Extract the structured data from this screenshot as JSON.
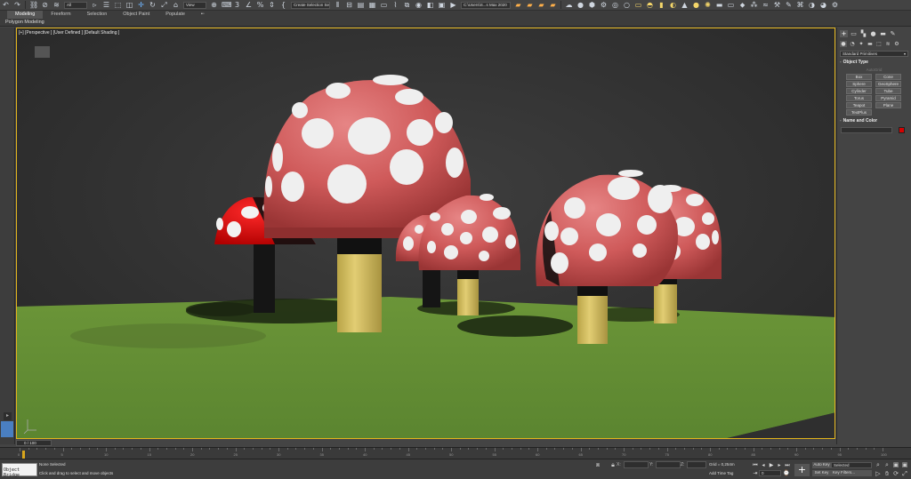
{
  "toolbar": {
    "icons_left": [
      "undo-icon",
      "redo-icon",
      "link-icon",
      "unlink-icon",
      "bind-space-warp-icon"
    ],
    "selection_filter": "All",
    "view_dropdown": "View",
    "named_selection": "Create Selection Se",
    "workspace": "C:\\Users\\S...s Max 2020"
  },
  "ribbon": {
    "tabs": [
      "Modeling",
      "Freeform",
      "Selection",
      "Object Paint",
      "Populate"
    ],
    "active_tab": "Modeling",
    "sub_label": "Polygon Modeling"
  },
  "viewport": {
    "label": "[+] [Perspective ] [User Defined ] [Default Shading ]"
  },
  "command_panel": {
    "primitive_type": "Standard Primitives",
    "object_type_title": "Object Type",
    "autogrid": "AutoGrid",
    "buttons": [
      "Box",
      "Cone",
      "Sphere",
      "GeoSphere",
      "Cylinder",
      "Tube",
      "Torus",
      "Pyramid",
      "Teapot",
      "Plane",
      "TextPlus"
    ],
    "name_color_title": "Name and Color",
    "object_color": "#d60000"
  },
  "timeline": {
    "frame_counter": "0 / 100",
    "ticks": [
      0,
      5,
      10,
      15,
      20,
      25,
      30,
      35,
      40,
      45,
      50,
      55,
      60,
      65,
      70,
      75,
      80,
      85,
      90,
      95,
      100
    ]
  },
  "status": {
    "maxscript": "Object Bridge",
    "selection": "None Selected",
    "prompt": "Click and drag to select and move objects",
    "x_label": "X:",
    "y_label": "Y:",
    "z_label": "Z:",
    "grid": "Grid = 0,254m",
    "add_time_tag": "Add Time Tag",
    "frame_value": "0",
    "auto_key": "Auto Key",
    "set_key": "Set Key",
    "selected": "Selected",
    "key_filters": "Key Filters..."
  }
}
